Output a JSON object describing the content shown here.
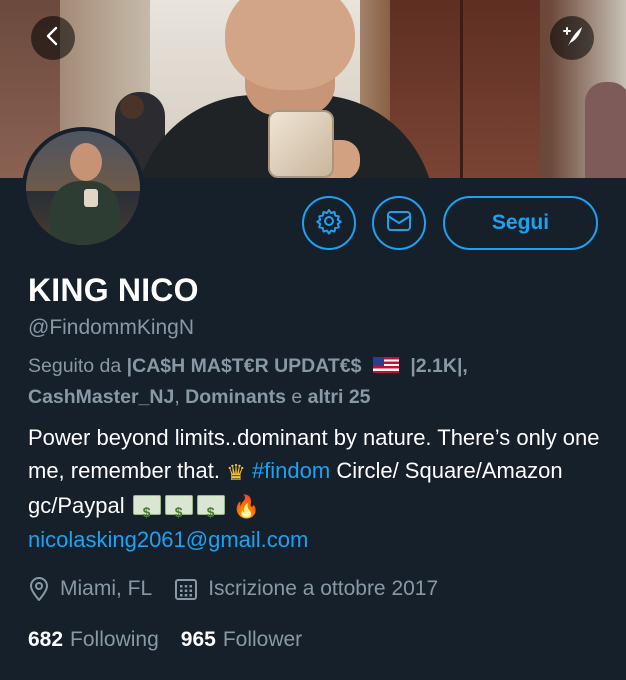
{
  "header": {
    "back_icon": "chevron-left-icon",
    "compose_icon": "compose-quill-icon"
  },
  "actions": {
    "settings_icon": "gear-icon",
    "message_icon": "envelope-icon",
    "follow_label": "Segui"
  },
  "profile": {
    "name": "KING NICO",
    "handle": "@FindommKingN",
    "followed_by": {
      "prefix": "Seguito da",
      "account1": "|CA$H MA$T€R UPDAT€$",
      "account1_suffix": "|2.1K|,",
      "account2": "CashMaster_NJ",
      "account3": "Dominants",
      "conjunction": "e",
      "others": "altri 25"
    },
    "bio": {
      "line1": "Power beyond limits..dominant by nature. There’s only one me, remember that.",
      "hashtag": "#findom",
      "line2": "Circle/ Square/Amazon gc/Paypal",
      "email": "nicolasking2061@gmail.com"
    },
    "location": "Miami, FL",
    "joined": "Iscrizione a ottobre 2017",
    "following_count": "682",
    "following_label": "Following",
    "followers_count": "965",
    "followers_label": "Follower"
  },
  "colors": {
    "background": "#15202b",
    "accent": "#1da1f2",
    "muted": "#8899a6",
    "text": "#ffffff"
  }
}
